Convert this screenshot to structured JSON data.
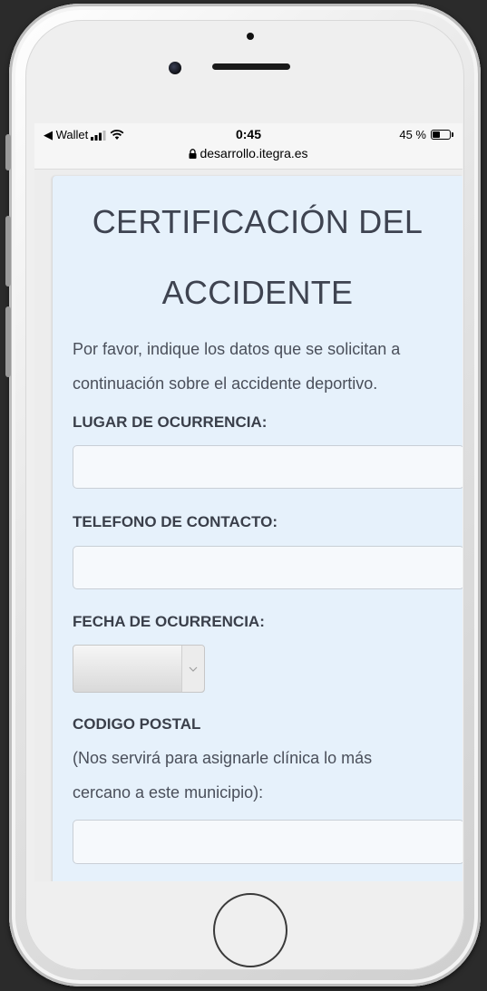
{
  "status_bar": {
    "back_app": "◀ Wallet",
    "time": "0:45",
    "url": "desarrollo.itegra.es",
    "battery": "45 %",
    "battery_level": 0.45
  },
  "form": {
    "title_line1": "CERTIFICACIÓN DEL",
    "title_line2": "ACCIDENTE",
    "intro_line1": "Por favor, indique los datos que se solicitan a",
    "intro_line2": "continuación sobre el accidente deportivo.",
    "lugar_label": "LUGAR DE OCURRENCIA:",
    "lugar_value": "",
    "telefono_label": "TELEFONO DE CONTACTO:",
    "telefono_value": "",
    "fecha_label": "FECHA DE OCURRENCIA:",
    "fecha_value": "",
    "codigo_label": "CODIGO POSTAL",
    "codigo_hint_line1": "(Nos servirá para asignarle clínica lo más",
    "codigo_hint_line2": "cercano a este municipio):",
    "codigo_value": ""
  },
  "icons": {
    "lock": "lock-icon",
    "signal": "signal-icon",
    "wifi": "wifi-icon",
    "battery": "battery-icon",
    "chevron": "chevron-down-icon"
  },
  "colors": {
    "card_background": "#e6f1fb",
    "title_text": "#3e4350"
  }
}
